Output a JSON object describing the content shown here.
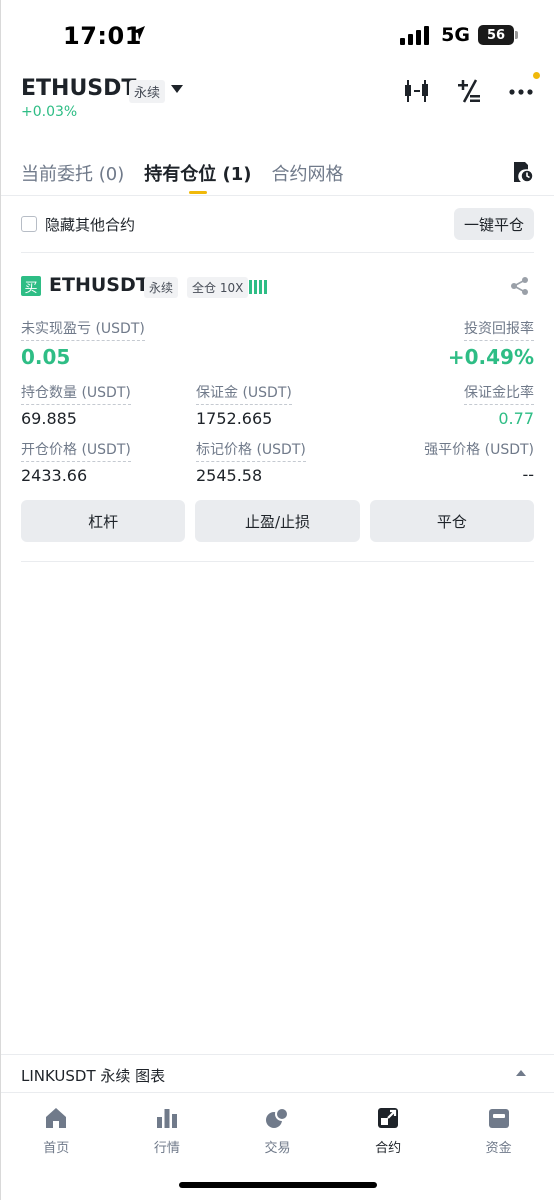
{
  "status_bar": {
    "time": "17:01",
    "network": "5G",
    "battery": "56"
  },
  "header": {
    "symbol": "ETHUSDT",
    "contract_type": "永续",
    "change": "+0.03%"
  },
  "tabs": [
    {
      "label": "当前委托 (0)",
      "active": false
    },
    {
      "label": "持有仓位 (1)",
      "active": true
    },
    {
      "label": "合约网格",
      "active": false
    }
  ],
  "filter": {
    "hide_others_label": "隐藏其他合约",
    "close_all_label": "一键平仓"
  },
  "position": {
    "side": "买",
    "symbol": "ETHUSDT",
    "contract_type": "永续",
    "margin_mode": "全仓 10X",
    "unrealized_pnl_label": "未实现盈亏 (USDT)",
    "unrealized_pnl_value": "0.05",
    "roi_label": "投资回报率",
    "roi_value": "+0.49%",
    "size_label": "持仓数量 (USDT)",
    "size_value": "69.885",
    "margin_label": "保证金 (USDT)",
    "margin_value": "1752.665",
    "margin_ratio_label": "保证金比率",
    "margin_ratio_value": "0.77",
    "entry_price_label": "开仓价格 (USDT)",
    "entry_price_value": "2433.66",
    "mark_price_label": "标记价格 (USDT)",
    "mark_price_value": "2545.58",
    "liq_price_label": "强平价格 (USDT)",
    "liq_price_value": "--",
    "actions": {
      "leverage": "杠杆",
      "tpsl": "止盈/止损",
      "close": "平仓"
    }
  },
  "chart_bar": {
    "label": "LINKUSDT 永续  图表"
  },
  "bottom_nav": [
    {
      "label": "首页",
      "icon": "home-icon"
    },
    {
      "label": "行情",
      "icon": "markets-icon"
    },
    {
      "label": "交易",
      "icon": "trade-icon"
    },
    {
      "label": "合约",
      "icon": "futures-icon",
      "active": true
    },
    {
      "label": "资金",
      "icon": "wallet-icon"
    }
  ],
  "colors": {
    "accent": "#f0b90b",
    "positive": "#2ebd85",
    "text_primary": "#1e2329",
    "text_secondary": "#707a8a"
  }
}
